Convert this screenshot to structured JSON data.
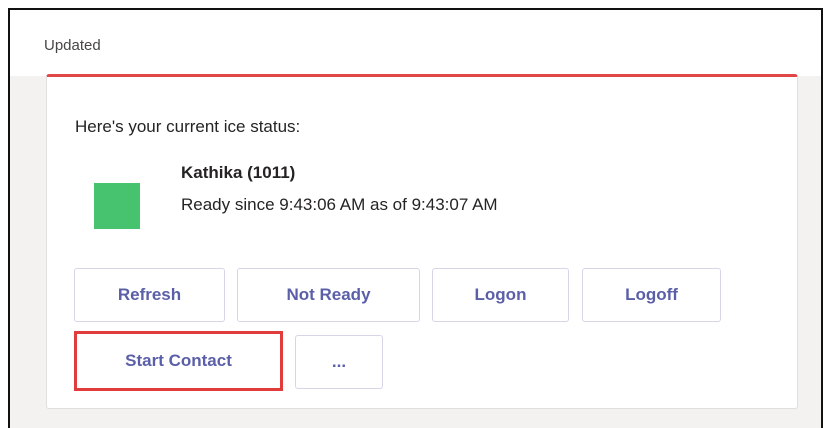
{
  "header": {
    "updated_label": "Updated"
  },
  "card": {
    "intro": "Here's your current ice status:",
    "agent_name": "Kathika (1011)",
    "agent_status": "Ready since 9:43:06 AM as of 9:43:07 AM",
    "status_color": "#47c26f",
    "accent_color": "#e04848"
  },
  "actions": {
    "refresh": "Refresh",
    "not_ready": "Not Ready",
    "logon": "Logon",
    "logoff": "Logoff",
    "start_contact": "Start Contact",
    "more": "..."
  }
}
